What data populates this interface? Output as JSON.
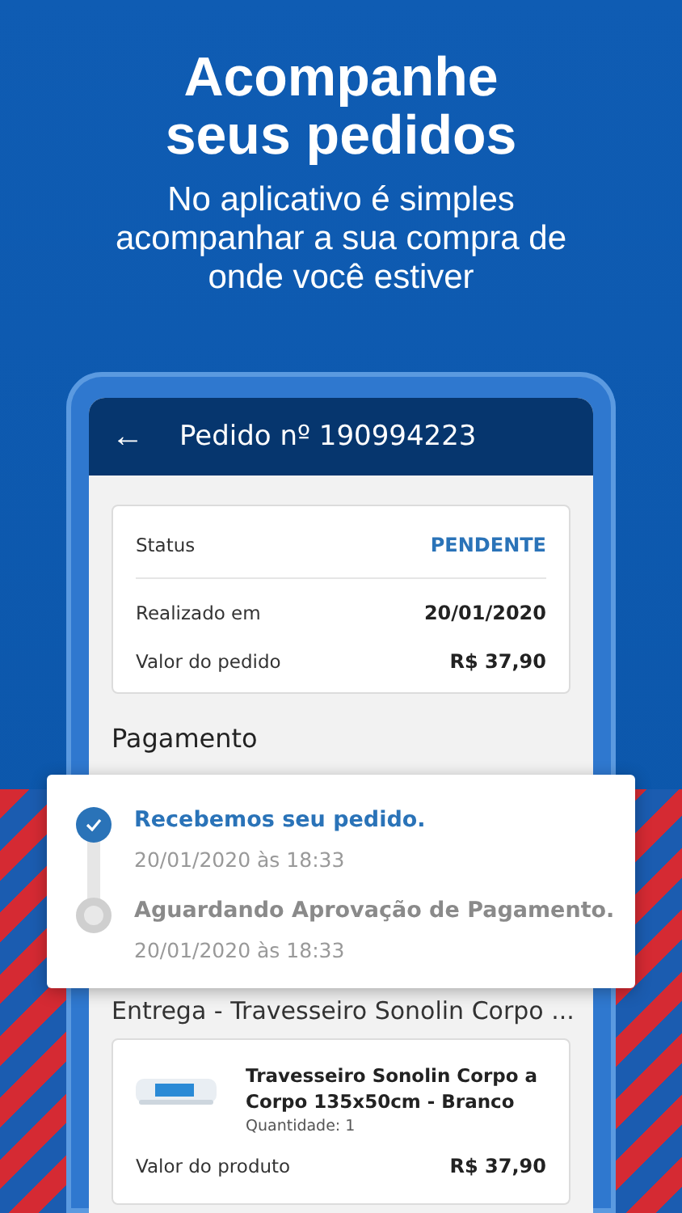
{
  "headline": "Acompanhe seus pedidos",
  "subtitle": "No aplicativo é simples acompanhar a sua compra de onde você estiver",
  "app_bar": {
    "back": "←",
    "title": "Pedido nº 190994223"
  },
  "summary": [
    {
      "label": "Status",
      "value": "PENDENTE",
      "kind": "status"
    },
    {
      "label": "Realizado em",
      "value": "20/01/2020",
      "kind": "plain"
    },
    {
      "label": "Valor do pedido",
      "value": "R$ 37,90",
      "kind": "plain"
    }
  ],
  "payment_heading": "Pagamento",
  "timeline": [
    {
      "title": "Recebemos seu pedido.",
      "time": "20/01/2020 às 18:33",
      "done": true
    },
    {
      "title": "Aguardando Aprovação de Pagamento.",
      "time": "20/01/2020 às 18:33",
      "done": false
    }
  ],
  "delivery_heading": "Entrega - Travesseiro Sonolin Corpo ...",
  "product": {
    "name": "Travesseiro Sonolin Corpo a Corpo 135x50cm - Branco",
    "quantity": "Quantidade: 1",
    "price_label": "Valor do produto",
    "price": "R$ 37,90"
  }
}
